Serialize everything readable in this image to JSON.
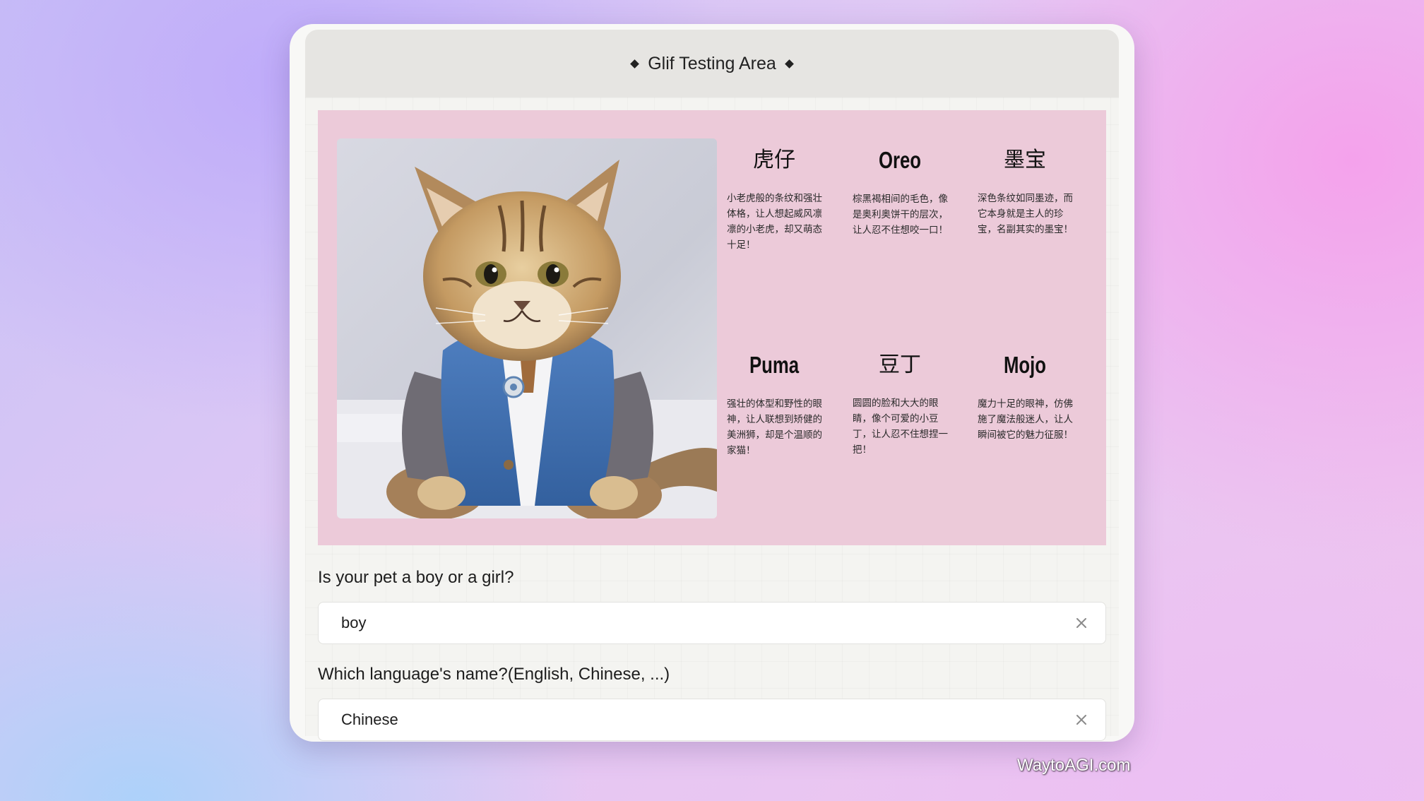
{
  "window": {
    "title": "Glif Testing Area"
  },
  "card": {
    "image_subject": "cat in blue suit",
    "names": [
      {
        "name": "虎仔",
        "description": "小老虎般的条纹和强壮体格，让人想起威风凛凛的小老虎，却又萌态十足！"
      },
      {
        "name": "Oreo",
        "description": "棕黑褐相间的毛色，像是奥利奥饼干的层次，让人忍不住想咬一口！"
      },
      {
        "name": "墨宝",
        "description": "深色条纹如同墨迹，而它本身就是主人的珍宝，名副其实的墨宝！"
      },
      {
        "name": "Puma",
        "description": "强壮的体型和野性的眼神，让人联想到矫健的美洲狮，却是个温顺的家猫！"
      },
      {
        "name": "豆丁",
        "description": "圆圆的脸和大大的眼睛，像个可爱的小豆丁，让人忍不住想捏一把！"
      },
      {
        "name": "Mojo",
        "description": "魔力十足的眼神，仿佛施了魔法般迷人，让人瞬间被它的魅力征服！"
      }
    ]
  },
  "inputs": {
    "gender": {
      "label": "Is your pet a boy or a girl?",
      "value": "boy"
    },
    "language": {
      "label": "Which language's name?(English, Chinese, ...)",
      "value": "Chinese"
    }
  },
  "watermark": "WaytoAGI.com",
  "colors": {
    "card_background": "#eccad9",
    "titlebar_background": "#e6e5e2",
    "window_background": "#f8f8f6"
  },
  "icons": {
    "clear": "close-icon",
    "title_ornament": "diamond-icon"
  }
}
